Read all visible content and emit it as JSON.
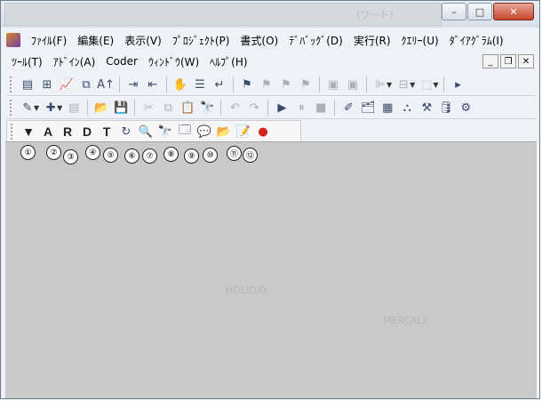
{
  "window": {
    "title": "(ワード)",
    "caption": {
      "minimize": "–",
      "maximize": "□",
      "close": "✕"
    }
  },
  "menu": {
    "row1": [
      "ﾌｧｲﾙ(F)",
      "編集(E)",
      "表示(V)",
      "ﾌﾟﾛｼﾞｪｸﾄ(P)",
      "書式(O)",
      "ﾃﾞﾊﾞｯｸﾞ(D)",
      "実行(R)",
      "ｸｴﾘｰ(U)",
      "ﾀﾞｲｱｸﾞﾗﾑ(I)"
    ],
    "row2": [
      "ﾂｰﾙ(T)",
      "ｱﾄﾞｲﾝ(A)",
      "Coder",
      "ｳｨﾝﾄﾞｳ(W)",
      "ﾍﾙﾌﾟ(H)"
    ],
    "mdi": {
      "minimize": "_",
      "restore": "❐",
      "close": "✕"
    }
  },
  "toolbar3": {
    "filter": "▼",
    "a": "A",
    "r": "R",
    "d": "D",
    "t": "T"
  },
  "callouts": [
    "①",
    "②",
    "③",
    "④",
    "⑤",
    "⑥",
    "⑦",
    "⑧",
    "⑨",
    "⑩",
    "⑪",
    "⑫"
  ],
  "content": {
    "ghost1": "HOLIDAY",
    "ghost2": "MERCALE"
  }
}
